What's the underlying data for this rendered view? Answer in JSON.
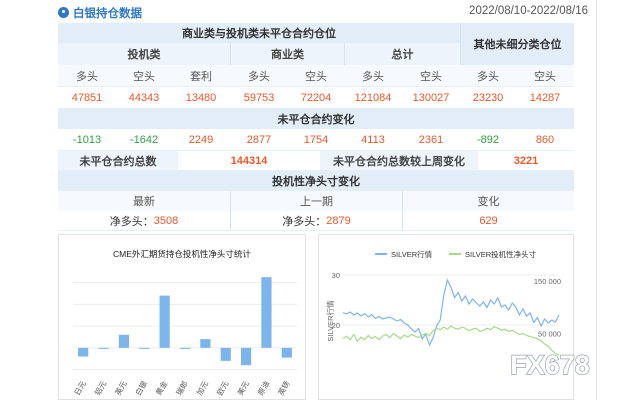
{
  "header": {
    "title": "白银持仓数据",
    "date_range": "2022/08/10-2022/08/16"
  },
  "table": {
    "group_commercial_noncommercial": "商业类与投机类未平仓合约仓位",
    "group_other": "其他未细分类仓位",
    "sub_speculative": "投机类",
    "sub_commercial": "商业类",
    "sub_total": "总计",
    "col_labels": [
      "多头",
      "空头",
      "套利",
      "多头",
      "空头",
      "多头",
      "空头",
      "多头",
      "空头"
    ],
    "positions": [
      "47851",
      "44343",
      "13480",
      "59753",
      "72204",
      "121084",
      "130027",
      "23230",
      "14287"
    ],
    "change_title": "未平仓合约变化",
    "changes": [
      "-1013",
      "-1642",
      "2249",
      "2877",
      "1754",
      "4113",
      "2361",
      "-892",
      "860"
    ],
    "open_interest_label": "未平仓合约总数",
    "open_interest_value": "144314",
    "oi_change_label": "未平仓合约总数较上周变化",
    "oi_change_value": "3221",
    "net_title": "投机性净头寸变化",
    "net_col_latest": "最新",
    "net_col_prev": "上一期",
    "net_col_change": "变化",
    "net_latest_label": "净多头：",
    "net_latest_value": "3508",
    "net_prev_label": "净多头：",
    "net_prev_value": "2879",
    "net_change_value": "629"
  },
  "colors": {
    "accent_blue": "#2f78c4",
    "header_bg": "#e3edf8",
    "positive_red": "#e8592c",
    "negative_green": "#2f9e44",
    "bar_blue": "#7cb5ec",
    "line_blue": "#7cb5ec",
    "line_green": "#a6d98a"
  },
  "chart_data": [
    {
      "type": "bar",
      "title": "CME外汇期货持仓投机性净头寸统计",
      "categories": [
        "日元",
        "铝元",
        "英元",
        "白银",
        "黄金",
        "瑞郎",
        "加元",
        "欧元",
        "美元",
        "原油",
        "英镑"
      ],
      "values": [
        -0.8,
        0,
        1.2,
        0,
        4.8,
        -0.1,
        0.8,
        -1.2,
        -1.6,
        6.5,
        -0.9
      ],
      "ylim": [
        -2.5,
        7.8
      ],
      "grid": true,
      "legend": "none"
    },
    {
      "type": "line",
      "legend": "top",
      "series": [
        {
          "name": "SILVER行情",
          "axis": "left",
          "values": [
            22.5,
            22.2,
            22.6,
            22.0,
            22.4,
            21.8,
            22.3,
            21.6,
            22.1,
            21.3,
            21.7,
            21.2,
            21.4,
            21.6,
            21.2,
            20.8,
            21.1,
            20.4,
            20.0,
            19.2,
            18.6,
            19.3,
            17.2,
            18.2,
            16.0,
            17.4,
            19.8,
            21.0,
            26.0,
            29.0,
            27.5,
            25.5,
            26.5,
            24.8,
            25.8,
            24.2,
            25.2,
            24.5,
            23.8,
            24.6,
            23.5,
            25.0,
            24.2,
            25.4,
            23.6,
            24.0,
            23.0,
            24.4,
            23.6,
            22.0,
            23.2,
            21.8,
            22.4,
            20.5,
            21.5,
            19.8,
            21.2,
            20.4,
            21.0,
            20.6,
            22.0
          ],
          "ylim": [
            12,
            32
          ],
          "ticks": [
            20,
            30
          ]
        },
        {
          "name": "SILVER投机性净头寸",
          "axis": "right",
          "values": [
            40000,
            45000,
            38000,
            48000,
            35000,
            43000,
            38000,
            46000,
            40000,
            44000,
            38000,
            45000,
            48000,
            42000,
            50000,
            45000,
            40000,
            47000,
            43000,
            48000,
            45000,
            42000,
            47000,
            50000,
            46000,
            55000,
            60000,
            57000,
            62000,
            58000,
            64000,
            60000,
            58000,
            62000,
            60000,
            55000,
            58000,
            60000,
            54000,
            56000,
            60000,
            57000,
            63000,
            60000,
            56000,
            58000,
            54000,
            56000,
            52000,
            48000,
            50000,
            46000,
            44000,
            42000,
            40000,
            36000,
            30000,
            26000,
            18000,
            12000,
            9000
          ],
          "ylim": [
            -10000,
            180000
          ],
          "ticks": [
            50000,
            150000
          ],
          "tick_labels": [
            "50 000",
            "150 000"
          ]
        }
      ],
      "ylabel": "SILVER行情",
      "grid": true
    }
  ]
}
